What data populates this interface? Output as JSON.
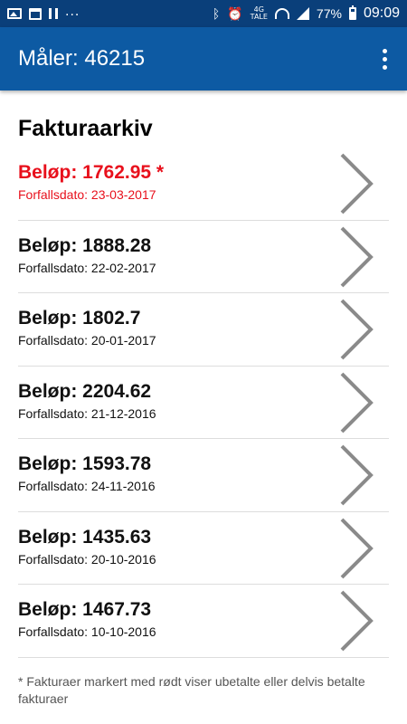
{
  "status_bar": {
    "left_icons": [
      "image-icon",
      "calendar-icon",
      "pause-icon"
    ],
    "more": "...",
    "network": "4G",
    "network_sub": "TALE",
    "battery": "77%",
    "time": "09:09"
  },
  "app_bar": {
    "title": "Måler: 46215"
  },
  "section": {
    "title": "Fakturaarkiv"
  },
  "invoices": [
    {
      "amount": "Beløp: 1762.95 *",
      "due": "Forfallsdato: 23-03-2017",
      "unpaid": true
    },
    {
      "amount": "Beløp: 1888.28",
      "due": "Forfallsdato: 22-02-2017",
      "unpaid": false
    },
    {
      "amount": "Beløp: 1802.7",
      "due": "Forfallsdato: 20-01-2017",
      "unpaid": false
    },
    {
      "amount": "Beløp: 2204.62",
      "due": "Forfallsdato: 21-12-2016",
      "unpaid": false
    },
    {
      "amount": "Beløp: 1593.78",
      "due": "Forfallsdato: 24-11-2016",
      "unpaid": false
    },
    {
      "amount": "Beløp: 1435.63",
      "due": "Forfallsdato: 20-10-2016",
      "unpaid": false
    },
    {
      "amount": "Beløp: 1467.73",
      "due": "Forfallsdato: 10-10-2016",
      "unpaid": false
    }
  ],
  "footnote": "* Fakturaer markert med rødt viser ubetalte eller delvis betalte fakturaer",
  "colors": {
    "status_bar": "#0a3f7a",
    "app_bar": "#0d5aa3",
    "unpaid": "#e8101c",
    "divider": "#dddddd",
    "chevron": "#8a8a8a"
  }
}
